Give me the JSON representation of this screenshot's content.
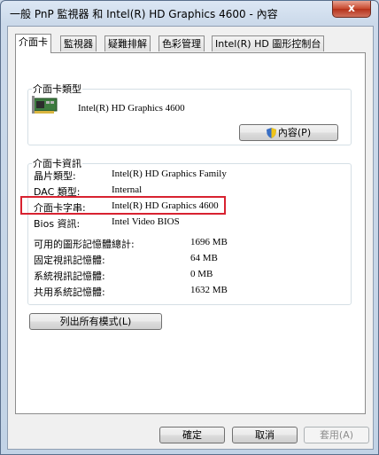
{
  "window": {
    "title": "一般 PnP 監視器 和 Intel(R) HD Graphics 4600 - 內容",
    "close_label": "x"
  },
  "tabs": [
    "介面卡",
    "監視器",
    "疑難排解",
    "色彩管理",
    "Intel(R) HD 圖形控制台"
  ],
  "adapter_type": {
    "legend": "介面卡類型",
    "name": "Intel(R) HD Graphics 4600",
    "properties_button": "內容(P)"
  },
  "adapter_info": {
    "legend": "介面卡資訊",
    "fields": [
      {
        "label": "晶片類型:",
        "value": "Intel(R) HD Graphics Family"
      },
      {
        "label": "DAC 類型:",
        "value": "Internal"
      },
      {
        "label": "介面卡字串:",
        "value": "Intel(R) HD Graphics 4600"
      },
      {
        "label": "Bios 資訊:",
        "value": "Intel Video BIOS"
      }
    ],
    "memory": [
      {
        "label": "可用的圖形記憶體總計:",
        "value": "1696 MB"
      },
      {
        "label": "固定視訊記憶體:",
        "value": "64 MB"
      },
      {
        "label": "系統視訊記憶體:",
        "value": "0 MB"
      },
      {
        "label": "共用系統記憶體:",
        "value": "1632 MB"
      }
    ]
  },
  "list_modes_button": "列出所有模式(L)",
  "footer": {
    "ok": "確定",
    "cancel": "取消",
    "apply": "套用(A)"
  },
  "colors": {
    "highlight_border": "#d82230"
  }
}
